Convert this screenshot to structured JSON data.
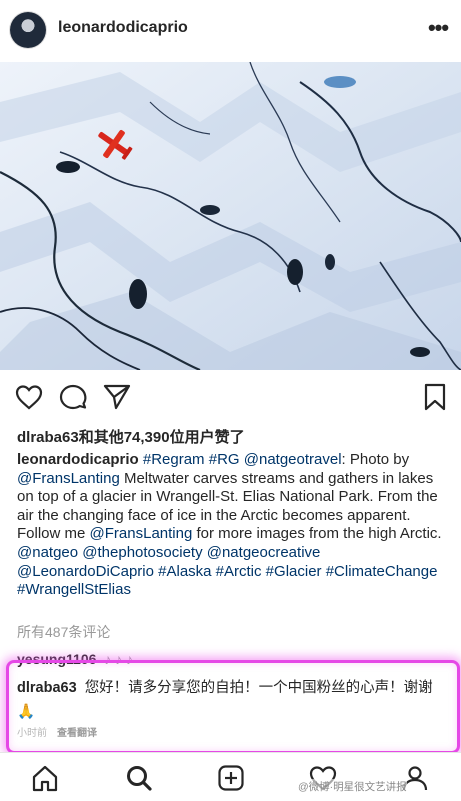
{
  "post": {
    "username": "leonardodicaprio",
    "more_icon": "ellipsis-icon"
  },
  "actions": {
    "like_icon": "heart-icon",
    "comment_icon": "comment-icon",
    "share_icon": "send-icon",
    "save_icon": "bookmark-icon"
  },
  "likes": {
    "text": "dlraba63和其他74,390位用户赞了"
  },
  "caption": {
    "username": "leonardodicaprio",
    "body_1": " ",
    "tag_regram": "#Regram",
    "body_2": " ",
    "tag_rg": "#RG",
    "body_3": " ",
    "mention_natgeotravel": "@natgeotravel",
    "body_4": ": Photo by ",
    "mention_franslanting": "@FransLanting",
    "body_5": " Meltwater carves streams and gathers in lakes on top of a glacier in Wrangell-St. Elias National Park. From the air the changing face of ice in the Arctic becomes apparent. Follow me ",
    "mention_franslanting_2": "@FransLanting",
    "body_6": " for more images from the high Arctic.",
    "tags_line": "@natgeo @thephotosociety @natgeocreative @LeonardoDiCaprio #Alaska #Arctic #Glacier #ClimateChange #WrangellStElias"
  },
  "comments": {
    "view_all": "所有487条评论",
    "first_user": "yesung1106",
    "first_text": "♪ ♪ ♪",
    "second_user": "dlraba63",
    "second_text": "您好！请多分享您的自拍！一个中国粉丝的心声！谢谢🙏",
    "time": "小时前",
    "translate": "查看翻译"
  },
  "tabbar": {
    "home_icon": "home-icon",
    "search_icon": "search-icon",
    "add_icon": "add-post-icon",
    "activity_icon": "heart-icon",
    "profile_icon": "profile-icon"
  },
  "watermark": "@微博·明星很文艺讲报",
  "colors": {
    "highlight": "#e548e6",
    "link": "#003569",
    "text": "#262626",
    "muted": "#999999"
  }
}
